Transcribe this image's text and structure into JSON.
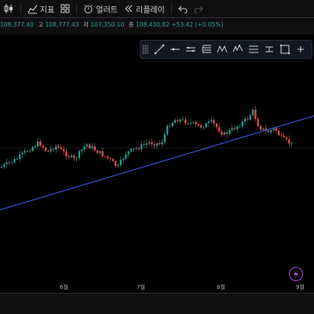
{
  "toolbar": {
    "indicators_label": "지표",
    "alerts_label": "얼러트",
    "replay_label": "리플레이"
  },
  "ohlc": {
    "open_value": "108,377.40",
    "high_label": "고",
    "high_value": "108,777.43",
    "low_label": "저",
    "low_value": "107,350.10",
    "close_label": "종",
    "close_value": "108,430.82",
    "change": "+53.42 (+0.05%)"
  },
  "drawing_tools": [
    "trend-line",
    "horizontal-ray",
    "parallel-channel",
    "fib-retracement",
    "xabcd-pattern",
    "elliott-wave",
    "long-position",
    "date-range",
    "rectangle",
    "more"
  ],
  "time_axis": {
    "months": [
      "6월",
      "7월",
      "8월",
      "9월"
    ]
  },
  "colors": {
    "up": "#26a69a",
    "down": "#ef5350",
    "trendline": "#3f51d6",
    "background": "#000000"
  }
}
